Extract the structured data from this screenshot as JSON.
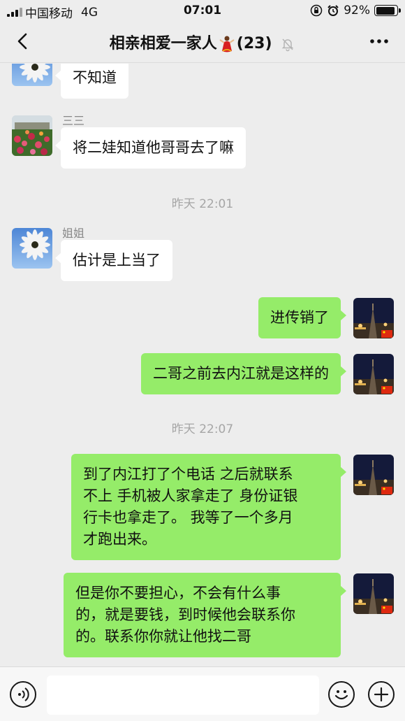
{
  "status_bar": {
    "carrier": "中国移动",
    "network": "4G",
    "time": "07:01",
    "battery": "92%",
    "battery_level": 0.92
  },
  "nav": {
    "title": "相亲相爱一家人",
    "count": "(23)"
  },
  "messages": {
    "m1": {
      "text": "不知道"
    },
    "m2": {
      "sender": "三三",
      "text": "将二娃知道他哥哥去了嘛"
    },
    "sep1": "昨天 22:01",
    "m3": {
      "sender": "姐姐",
      "text": "估计是上当了"
    },
    "m4": {
      "text": "进传销了"
    },
    "m5": {
      "text": "二哥之前去内江就是这样的"
    },
    "sep2": "昨天 22:07",
    "m6": {
      "lines": [
        "到了内江打了个电话 之后就联系",
        "不上 手机被人家拿走了 身份证银",
        "行卡也拿走了。 我等了一个多月",
        "才跑出来。"
      ]
    },
    "m7": {
      "lines": [
        "但是你不要担心，不会有什么事",
        "的，就是要钱，到时候他会联系你",
        "的。联系你你就让他找二哥"
      ]
    }
  },
  "input": {
    "placeholder": ""
  },
  "colors": {
    "background": "#ededed",
    "outgoing_bubble": "#95ec69",
    "incoming_bubble": "#ffffff",
    "timestamp": "#a6a6a6"
  }
}
